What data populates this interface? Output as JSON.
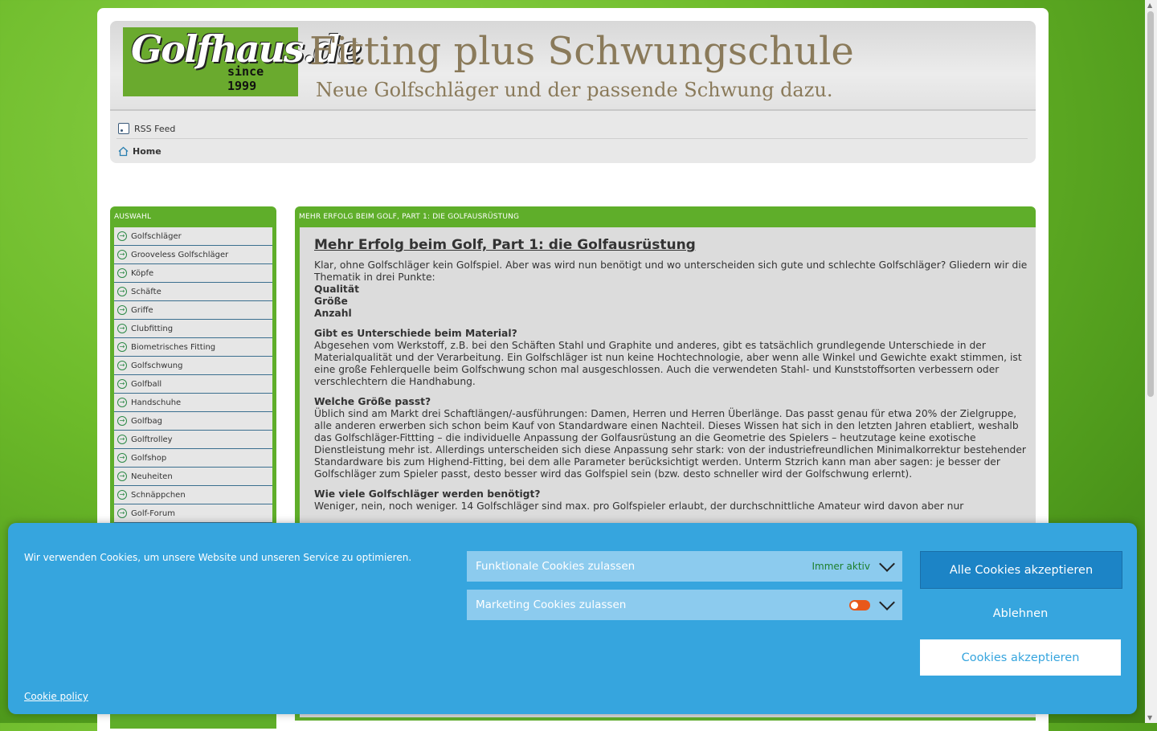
{
  "header": {
    "logo_text": "Golfhaus.de",
    "logo_since": "since 1999",
    "title": "Fitting plus Schwungschule",
    "subtitle": "Neue Golfschläger und der passende Schwung dazu."
  },
  "nav": {
    "rss_label": "RSS Feed",
    "home_label": "Home"
  },
  "sidebar": {
    "title": "AUSWAHL",
    "items": [
      {
        "label": "Golfschläger"
      },
      {
        "label": "Grooveless Golfschläger"
      },
      {
        "label": "Köpfe"
      },
      {
        "label": "Schäfte"
      },
      {
        "label": "Griffe"
      },
      {
        "label": "Clubfitting"
      },
      {
        "label": "Biometrisches Fitting"
      },
      {
        "label": "Golfschwung"
      },
      {
        "label": "Golfball"
      },
      {
        "label": "Handschuhe"
      },
      {
        "label": "Golfbag"
      },
      {
        "label": "Golftrolley"
      },
      {
        "label": "Golfshop"
      },
      {
        "label": "Neuheiten"
      },
      {
        "label": "Schnäppchen"
      },
      {
        "label": "Golf-Forum"
      }
    ]
  },
  "content": {
    "box_title": "MEHR ERFOLG BEIM GOLF, PART 1: DIE GOLFAUSRÜSTUNG",
    "title": "Mehr Erfolg beim Golf, Part 1: die Golfausrüstung",
    "intro": "Klar, ohne Golfschläger kein Golfspiel. Aber was wird nun benötigt und wo unterscheiden sich gute und schlechte Golfschläger? Gliedern wir die Thematik in drei Punkte:",
    "points": [
      "Qualität",
      "Größe",
      "Anzahl"
    ],
    "sections": [
      {
        "heading": "Gibt es Unterschiede beim Material?",
        "text": "Abgesehen vom Werkstoff, z.B. bei den Schäften Stahl und Graphite und anderes, gibt es tatsächlich grundlegende Unterschiede in der Materialqualität und der Verarbeitung. Ein Golfschläger ist nun keine Hochtechnologie, aber wenn alle Winkel und Gewichte exakt stimmen, ist eine große Fehlerquelle beim Golfschwung schon mal ausgeschlossen. Auch die verwendeten Stahl- und Kunststoffsorten verbessern oder verschlechtern die Handhabung."
      },
      {
        "heading": "Welche Größe passt?",
        "text": "Üblich sind am Markt drei Schaftlängen/-ausführungen: Damen, Herren und Herren Überlänge. Das passt genau für etwa 20% der Zielgruppe, alle anderen erwerben sich schon beim Kauf von Standardware einen Nachteil. Dieses Wissen hat sich in den letzten Jahren etabliert, weshalb das Golfschläger-Fittting – die individuelle Anpassung der Golfausrüstung an die Geometrie des Spielers – heutzutage keine exotische Dienstleistung mehr ist. Allerdings unterscheiden sich diese Anpassung sehr stark: von der industriefreundlichen Minimalkorrektur bestehender Standardware bis zum Highend-Fitting, bei dem alle Parameter berücksichtigt werden. Unterm Stzrich kann man aber sagen: je besser der Golfschläger zum Spieler passt, desto besser wird das Golfspiel sein (bzw. desto schneller wird der Golfschwung erlernt)."
      },
      {
        "heading": "Wie viele Golfschläger werden benötigt?",
        "text": "Weniger, nein, noch weniger. 14 Golfschläger sind max. pro Golfspieler erlaubt, der durchschnittliche Amateur wird davon aber nur"
      }
    ]
  },
  "cookie": {
    "message": "Wir verwenden Cookies, um unsere Website und unseren Service zu optimieren.",
    "policy_link": "Cookie policy",
    "functional_label": "Funktionale Cookies zulassen",
    "functional_status": "Immer aktiv",
    "marketing_label": "Marketing Cookies zulassen",
    "marketing_enabled": false,
    "accept_all": "Alle Cookies akzeptieren",
    "deny": "Ablehnen",
    "accept": "Cookies akzeptieren"
  },
  "colors": {
    "banner_bg": "#36a5de",
    "green_frame": "#5fae2a",
    "toggle_off": "#e8581a"
  }
}
